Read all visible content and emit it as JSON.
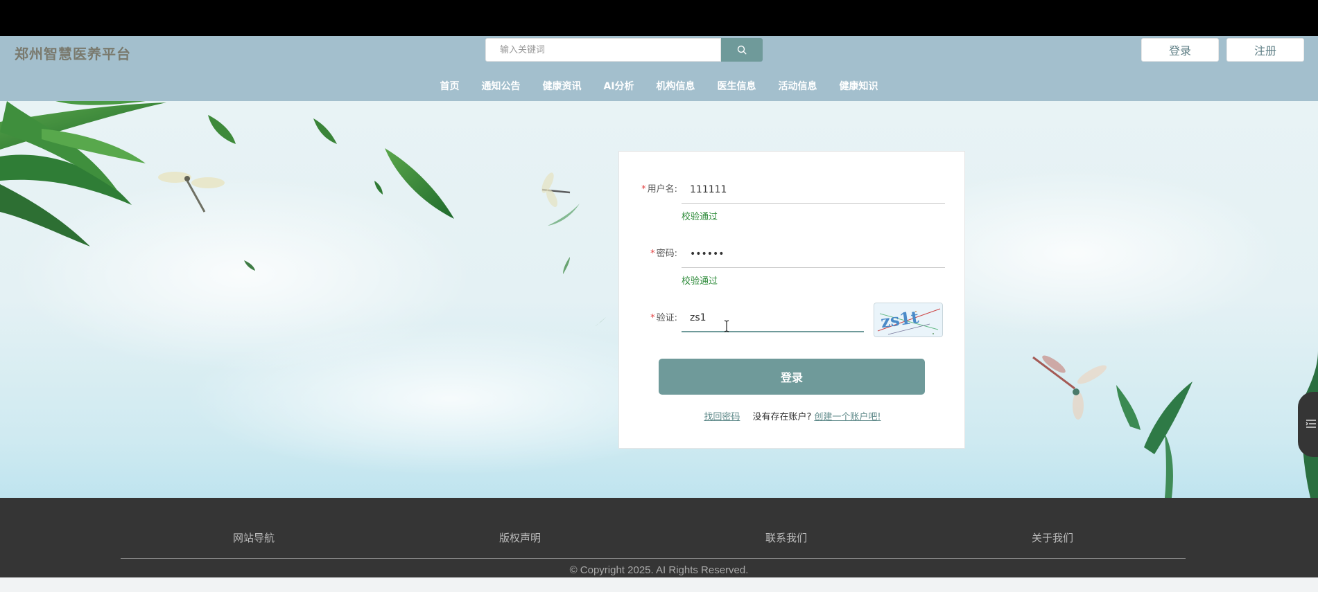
{
  "header": {
    "site_title": "郑州智慧医养平台",
    "search": {
      "placeholder": "输入关键词",
      "value": ""
    },
    "login_label": "登录",
    "register_label": "注册"
  },
  "nav": {
    "items": [
      {
        "label": "首页"
      },
      {
        "label": "通知公告"
      },
      {
        "label": "健康资讯"
      },
      {
        "label": "AI分析"
      },
      {
        "label": "机构信息"
      },
      {
        "label": "医生信息"
      },
      {
        "label": "活动信息"
      },
      {
        "label": "健康知识"
      }
    ]
  },
  "login_form": {
    "username": {
      "label": "用户名:",
      "value": "111111",
      "validation": "校验通过"
    },
    "password": {
      "label": "密码:",
      "value": "••••••",
      "validation": "校验通过"
    },
    "captcha": {
      "label": "验证:",
      "value": "zs1",
      "image_text": "zs1t"
    },
    "submit_label": "登录",
    "forgot_password": "找回密码",
    "no_account_text": "没有存在账户?",
    "create_account": "创建一个账户吧!"
  },
  "footer": {
    "links": [
      "网站导航",
      "版权声明",
      "联系我们",
      "关于我们"
    ],
    "copyright": "© Copyright 2025. AI Rights Reserved."
  },
  "colors": {
    "header_bg": "#a3bfcd",
    "accent": "#6f9a9a",
    "footer_bg": "#353535",
    "valid_green": "#2e8b3a",
    "required_red": "#e24343"
  },
  "icons": {
    "search": "search-icon",
    "side_tab": "menu-list-icon"
  }
}
